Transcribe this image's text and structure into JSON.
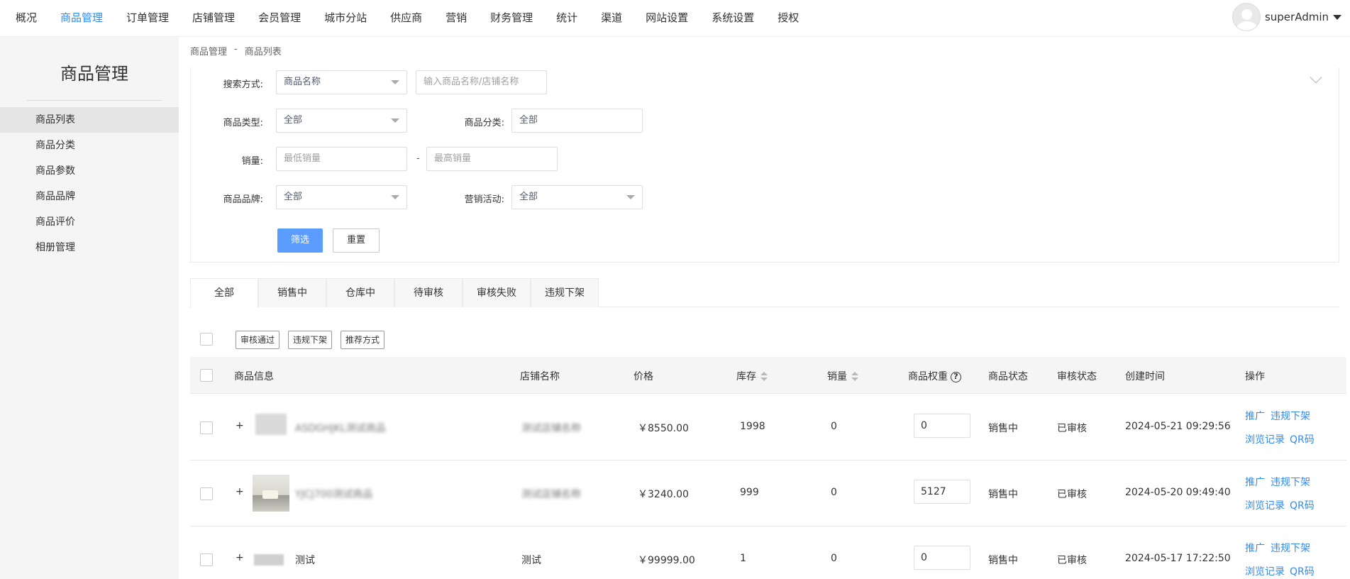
{
  "nav": {
    "items": [
      "概况",
      "商品管理",
      "订单管理",
      "店铺管理",
      "会员管理",
      "城市分站",
      "供应商",
      "营销",
      "财务管理",
      "统计",
      "渠道",
      "网站设置",
      "系统设置",
      "授权"
    ],
    "active_index": 1,
    "username": "superAdmin"
  },
  "sidebar": {
    "title": "商品管理",
    "items": [
      "商品列表",
      "商品分类",
      "商品参数",
      "商品品牌",
      "商品评价",
      "相册管理"
    ],
    "active_index": 0
  },
  "breadcrumb": [
    "商品管理",
    "-",
    "商品列表"
  ],
  "filter": {
    "search_mode_label": "搜索方式:",
    "search_mode_value": "商品名称",
    "search_placeholder": "输入商品名称/店铺名称",
    "type_label": "商品类型:",
    "type_value": "全部",
    "category_label": "商品分类:",
    "category_value": "全部",
    "sales_label": "销量:",
    "sales_min_placeholder": "最低销量",
    "sales_dash": "-",
    "sales_max_placeholder": "最高销量",
    "brand_label": "商品品牌:",
    "brand_value": "全部",
    "marketing_label": "营销活动:",
    "marketing_value": "全部",
    "filter_button": "筛选",
    "reset_button": "重置"
  },
  "tabs": [
    "全部",
    "销售中",
    "仓库中",
    "待审核",
    "审核失败",
    "违规下架"
  ],
  "active_tab": 0,
  "bulk_actions": [
    "审核通过",
    "违规下架",
    "推荐方式"
  ],
  "table": {
    "headers": {
      "info": "商品信息",
      "shop": "店铺名称",
      "price": "价格",
      "stock": "库存",
      "sales": "销量",
      "weight": "商品权重",
      "status": "商品状态",
      "audit": "审核状态",
      "created": "创建时间",
      "ops": "操作"
    },
    "rows": [
      {
        "plus": "+",
        "name": "ASDGHJKL测试商品",
        "shop": "测试店铺名称",
        "price": "￥8550.00",
        "stock": "1998",
        "sales": "0",
        "weight": "0",
        "status": "销售中",
        "audit": "已审核",
        "created": "2024-05-21 09:29:56",
        "ops": [
          "推广",
          "违规下架",
          "浏览记录",
          "QR码"
        ]
      },
      {
        "plus": "+",
        "name": "YJCJ700测试商品",
        "shop": "测试店铺名称",
        "price": "￥3240.00",
        "stock": "999",
        "sales": "0",
        "weight": "5127",
        "status": "销售中",
        "audit": "已审核",
        "created": "2024-05-20 09:49:40",
        "ops": [
          "推广",
          "违规下架",
          "浏览记录",
          "QR码"
        ]
      },
      {
        "plus": "+",
        "name": "测试",
        "shop": "测试",
        "price": "￥99999.00",
        "stock": "1",
        "sales": "0",
        "weight": "0",
        "status": "销售中",
        "audit": "已审核",
        "created": "2024-05-17 17:22:50",
        "ops": [
          "推广",
          "违规下架",
          "浏览记录",
          "QR码"
        ]
      }
    ]
  }
}
